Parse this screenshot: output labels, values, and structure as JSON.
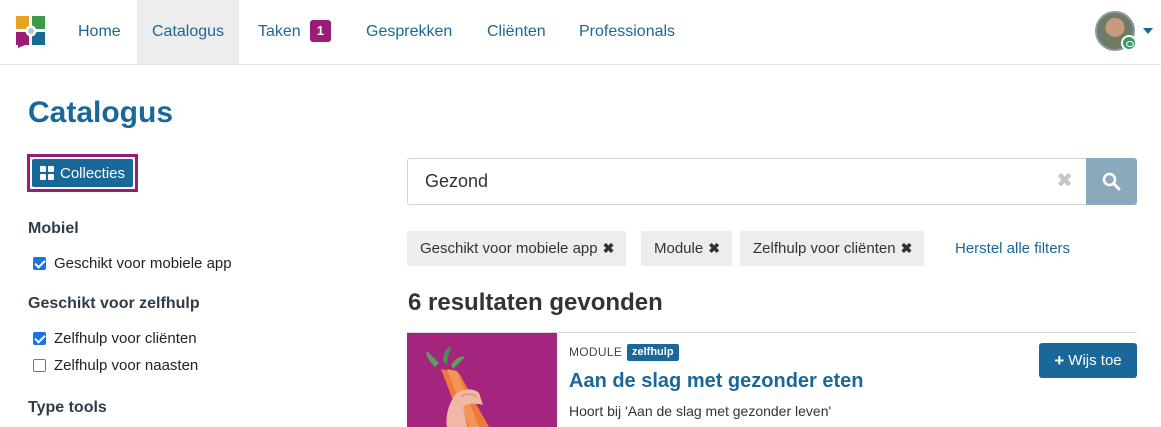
{
  "nav": {
    "items": [
      {
        "label": "Home"
      },
      {
        "label": "Catalogus"
      },
      {
        "label": "Taken",
        "badge": "1"
      },
      {
        "label": "Gesprekken"
      },
      {
        "label": "Cliënten"
      },
      {
        "label": "Professionals"
      }
    ],
    "active": "Catalogus"
  },
  "page": {
    "title": "Catalogus",
    "collections_button": "Collecties"
  },
  "facets": [
    {
      "title": "Mobiel",
      "options": [
        {
          "label": "Geschikt voor mobiele app",
          "checked": true
        }
      ]
    },
    {
      "title": "Geschikt voor zelfhulp",
      "options": [
        {
          "label": "Zelfhulp voor cliënten",
          "checked": true
        },
        {
          "label": "Zelfhulp voor naasten",
          "checked": false
        }
      ]
    },
    {
      "title": "Type tools",
      "options": []
    }
  ],
  "search": {
    "value": "Gezond",
    "clear_icon": "times-icon",
    "button_icon": "search-icon"
  },
  "filters": {
    "active": [
      {
        "label": "Geschikt voor mobiele app"
      },
      {
        "label": "Module"
      },
      {
        "label": "Zelfhulp voor cliënten"
      }
    ],
    "reset_label": "Herstel alle filters"
  },
  "results": {
    "count_text": "6 resultaten gevonden",
    "items": [
      {
        "type": "MODULE",
        "tag": "zelfhulp",
        "title": "Aan de slag met gezonder eten",
        "subtitle": "Hoort bij 'Aan de slag met gezonder leven'",
        "action": "Wijs toe"
      }
    ]
  },
  "colors": {
    "primary": "#1a6899",
    "accent": "#9c1b77",
    "chip_bg": "#ededed",
    "search_button": "#8aa9bb"
  }
}
